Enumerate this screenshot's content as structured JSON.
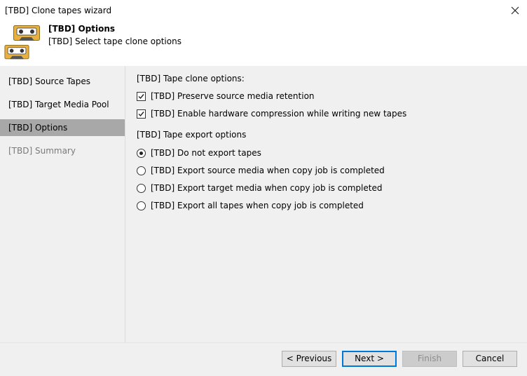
{
  "window": {
    "title": "[TBD] Clone tapes wizard",
    "close_icon": "close-icon"
  },
  "header": {
    "title": "[TBD] Options",
    "subtitle": "[TBD] Select tape clone options",
    "icon": "tape-cassette-icon"
  },
  "sidebar": {
    "items": [
      {
        "label": "[TBD] Source Tapes",
        "state": "normal"
      },
      {
        "label": "[TBD] Target Media Pool",
        "state": "normal"
      },
      {
        "label": "[TBD] Options",
        "state": "active"
      },
      {
        "label": "[TBD] Summary",
        "state": "disabled"
      }
    ]
  },
  "clone_options": {
    "label": "[TBD] Tape clone options:",
    "items": [
      {
        "label": "[TBD] Preserve source media retention",
        "checked": true
      },
      {
        "label": "[TBD] Enable hardware compression while writing new tapes",
        "checked": true
      }
    ]
  },
  "export_options": {
    "label": "[TBD] Tape export options",
    "items": [
      {
        "label": "[TBD] Do not export tapes",
        "selected": true
      },
      {
        "label": "[TBD] Export source media when copy job is completed",
        "selected": false
      },
      {
        "label": "[TBD] Export target media when copy job is completed",
        "selected": false
      },
      {
        "label": "[TBD] Export all tapes when copy job is completed",
        "selected": false
      }
    ]
  },
  "footer": {
    "previous": "< Previous",
    "next": "Next >",
    "finish": "Finish",
    "cancel": "Cancel"
  },
  "colors": {
    "active_nav": "#a8a8a8",
    "panel_bg": "#f0f0f0",
    "primary_border": "#0078d7",
    "tape_body": "#e8b03f"
  }
}
